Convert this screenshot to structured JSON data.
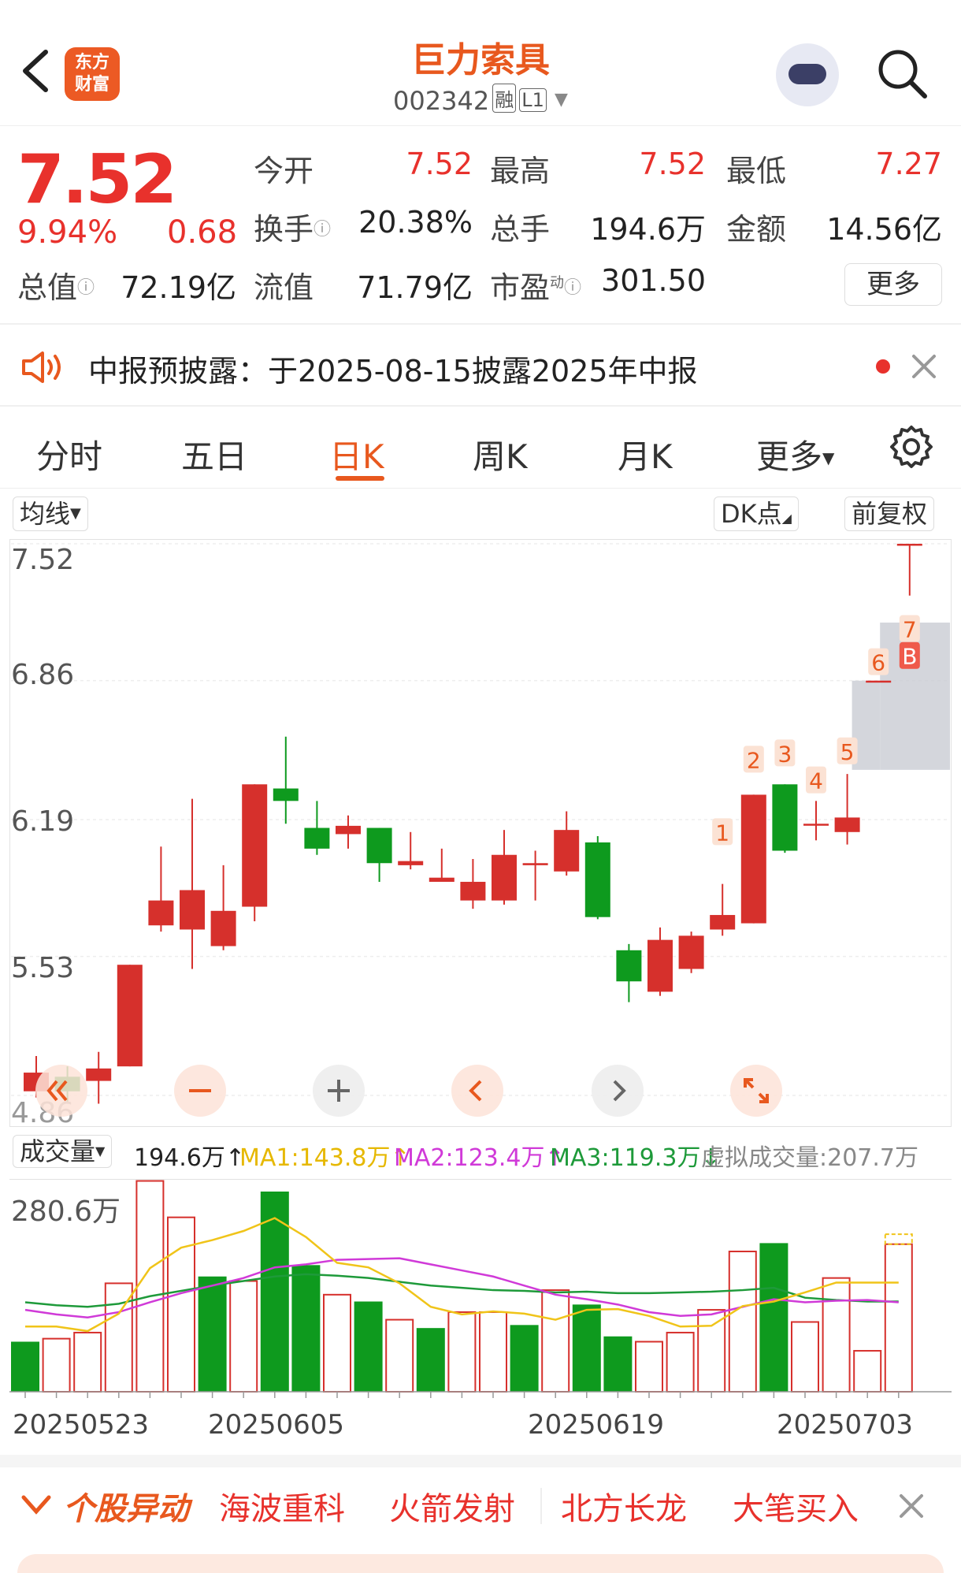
{
  "header": {
    "stock_name": "巨力索具",
    "stock_code": "002342",
    "tag_margin": "融",
    "tag_level": "L1",
    "logo_line1": "东方",
    "logo_line2": "财富"
  },
  "quote": {
    "price": "7.52",
    "change_pct": "9.94%",
    "change_amt": "0.68",
    "fields": [
      {
        "label": "今开",
        "value": "7.52"
      },
      {
        "label": "最高",
        "value": "7.52"
      },
      {
        "label": "最低",
        "value": "7.27"
      },
      {
        "label": "换手",
        "value": "20.38%"
      },
      {
        "label": "总手",
        "value": "194.6万"
      },
      {
        "label": "金额",
        "value": "14.56亿"
      },
      {
        "label": "总值",
        "value": "72.19亿"
      },
      {
        "label": "流值",
        "value": "71.79亿"
      },
      {
        "label": "市盈",
        "value": "301.50"
      }
    ],
    "pe_superscript": "动",
    "more": "更多"
  },
  "notice": {
    "text": "中报预披露：于2025-08-15披露2025年中报"
  },
  "tabs": [
    "分时",
    "五日",
    "日K",
    "周K",
    "月K",
    "更多"
  ],
  "active_tab": "日K",
  "chart_toolbar": {
    "ma_button": "均线",
    "dk_button": "DK点",
    "adjust_button": "前复权"
  },
  "chart_data": [
    {
      "type": "candlestick",
      "y_ticks": [
        "7.52",
        "6.86",
        "6.19",
        "5.53",
        "4.86"
      ],
      "ylim": [
        4.86,
        7.52
      ],
      "candles": [
        {
          "o": 4.88,
          "c": 4.97,
          "h": 5.05,
          "l": 4.85
        },
        {
          "o": 4.95,
          "c": 4.88,
          "h": 5.0,
          "l": 4.82
        },
        {
          "o": 4.93,
          "c": 4.99,
          "h": 5.07,
          "l": 4.82
        },
        {
          "o": 5.0,
          "c": 5.49,
          "h": 5.49,
          "l": 5.0
        },
        {
          "o": 5.68,
          "c": 5.8,
          "h": 6.06,
          "l": 5.65
        },
        {
          "o": 5.66,
          "c": 5.85,
          "h": 6.29,
          "l": 5.47
        },
        {
          "o": 5.58,
          "c": 5.75,
          "h": 5.97,
          "l": 5.56
        },
        {
          "o": 5.77,
          "c": 6.36,
          "h": 6.36,
          "l": 5.7
        },
        {
          "o": 6.34,
          "c": 6.28,
          "h": 6.59,
          "l": 6.17
        },
        {
          "o": 6.15,
          "c": 6.05,
          "h": 6.28,
          "l": 6.02
        },
        {
          "o": 6.12,
          "c": 6.16,
          "h": 6.21,
          "l": 6.05
        },
        {
          "o": 6.15,
          "c": 5.98,
          "h": 6.15,
          "l": 5.89
        },
        {
          "o": 5.97,
          "c": 5.99,
          "h": 6.13,
          "l": 5.95
        },
        {
          "o": 5.89,
          "c": 5.91,
          "h": 6.05,
          "l": 5.9
        },
        {
          "o": 5.8,
          "c": 5.89,
          "h": 6.0,
          "l": 5.76
        },
        {
          "o": 5.8,
          "c": 6.02,
          "h": 6.14,
          "l": 5.78
        },
        {
          "o": 5.97,
          "c": 5.98,
          "h": 6.04,
          "l": 5.8
        },
        {
          "o": 5.94,
          "c": 6.14,
          "h": 6.23,
          "l": 5.92
        },
        {
          "o": 6.08,
          "c": 5.72,
          "h": 6.11,
          "l": 5.71
        },
        {
          "o": 5.56,
          "c": 5.41,
          "h": 5.59,
          "l": 5.31
        },
        {
          "o": 5.36,
          "c": 5.61,
          "h": 5.67,
          "l": 5.34
        },
        {
          "o": 5.47,
          "c": 5.63,
          "h": 5.65,
          "l": 5.45
        },
        {
          "o": 5.66,
          "c": 5.73,
          "h": 5.88,
          "l": 5.63
        },
        {
          "o": 5.69,
          "c": 6.31,
          "h": 6.31,
          "l": 5.69
        },
        {
          "o": 6.36,
          "c": 6.04,
          "h": 6.36,
          "l": 6.03
        },
        {
          "o": 6.17,
          "c": 6.17,
          "h": 6.28,
          "l": 6.09
        },
        {
          "o": 6.13,
          "c": 6.2,
          "h": 6.41,
          "l": 6.07
        },
        {
          "o": 6.86,
          "c": 6.86,
          "h": 6.86,
          "l": 6.86
        },
        {
          "o": 7.52,
          "c": 7.52,
          "h": 7.52,
          "l": 7.27
        }
      ],
      "dk_labels": [
        {
          "i": 22,
          "label": "1",
          "at": 6.12
        },
        {
          "i": 23,
          "label": "2",
          "at": 6.47
        },
        {
          "i": 24,
          "label": "3",
          "at": 6.5
        },
        {
          "i": 25,
          "label": "4",
          "at": 6.37
        },
        {
          "i": 26,
          "label": "5",
          "at": 6.51
        },
        {
          "i": 27,
          "label": "6",
          "at": 6.94
        },
        {
          "i": 28,
          "label": "7",
          "at": 7.1
        },
        {
          "i": 28,
          "label": "B",
          "at": 6.97
        }
      ]
    },
    {
      "type": "bar",
      "title": "成交量",
      "current": "194.6万",
      "ma1": "MA1:143.8万",
      "ma2": "MA2:123.4万",
      "ma3": "MA3:119.3万",
      "virtual": "虚拟成交量:207.7万",
      "y_tick": "280.6万",
      "ylim": [
        0,
        280.6
      ],
      "volumes": [
        {
          "v": 66,
          "up": false
        },
        {
          "v": 70,
          "up": true
        },
        {
          "v": 78,
          "up": true
        },
        {
          "v": 143,
          "up": true
        },
        {
          "v": 278,
          "up": true
        },
        {
          "v": 230,
          "up": true
        },
        {
          "v": 152,
          "up": false
        },
        {
          "v": 146,
          "up": true
        },
        {
          "v": 264,
          "up": false
        },
        {
          "v": 167,
          "up": false
        },
        {
          "v": 128,
          "up": true
        },
        {
          "v": 119,
          "up": false
        },
        {
          "v": 95,
          "up": true
        },
        {
          "v": 84,
          "up": false
        },
        {
          "v": 105,
          "up": true
        },
        {
          "v": 105,
          "up": true
        },
        {
          "v": 88,
          "up": false
        },
        {
          "v": 134,
          "up": true
        },
        {
          "v": 115,
          "up": false
        },
        {
          "v": 73,
          "up": false
        },
        {
          "v": 66,
          "up": true
        },
        {
          "v": 78,
          "up": true
        },
        {
          "v": 108,
          "up": true
        },
        {
          "v": 185,
          "up": true
        },
        {
          "v": 196,
          "up": false
        },
        {
          "v": 92,
          "up": true
        },
        {
          "v": 150,
          "up": true
        },
        {
          "v": 54,
          "up": true
        },
        {
          "v": 194.6,
          "up": true
        }
      ],
      "ma1_values": [
        86,
        86,
        80,
        103,
        163,
        190,
        200,
        212,
        229,
        204,
        170,
        164,
        143,
        112,
        102,
        106,
        103,
        95,
        108,
        109,
        100,
        86,
        87,
        113,
        119,
        131,
        144,
        144,
        144
      ],
      "ma2_values": [
        108,
        102,
        98,
        105,
        118,
        130,
        140,
        150,
        164,
        168,
        174,
        175,
        176,
        168,
        160,
        152,
        140,
        128,
        122,
        115,
        105,
        100,
        102,
        112,
        122,
        118,
        120,
        121,
        118
      ],
      "ma3_values": [
        118,
        114,
        112,
        116,
        126,
        133,
        140,
        146,
        152,
        155,
        153,
        150,
        145,
        140,
        137,
        134,
        133,
        131,
        132,
        130,
        130,
        131,
        132,
        134,
        137,
        124,
        121,
        119,
        119
      ],
      "dates": [
        "20250523",
        "20250605",
        "20250619",
        "20250703"
      ]
    }
  ],
  "stock_news": {
    "title": "个股异动",
    "items": [
      "海波重科",
      "火箭发射",
      "北方长龙",
      "大笔买入"
    ]
  },
  "colors": {
    "brand": "#e8581e",
    "up": "#d6302c",
    "down": "#0e9a1e",
    "ma1": "#f0c419",
    "ma2": "#d03ad8",
    "ma3": "#1e9a3a"
  }
}
